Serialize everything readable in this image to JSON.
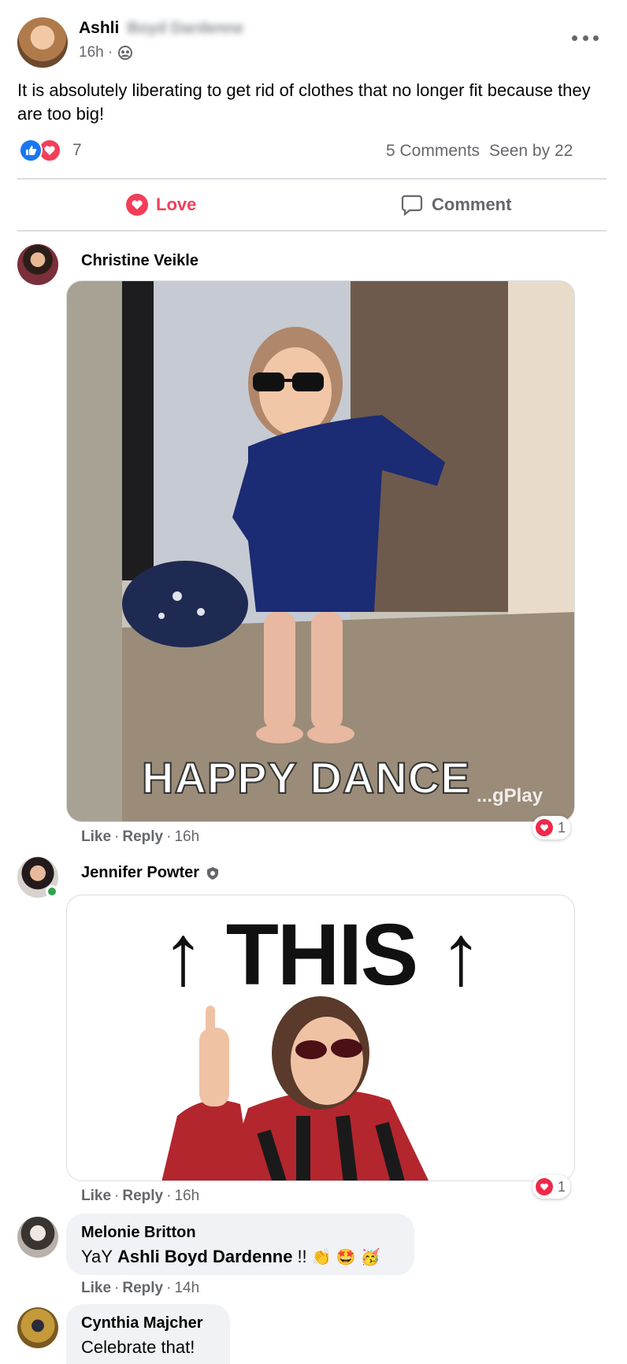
{
  "post": {
    "author_first": "Ashli",
    "author_blurred": "Boyd Dardenne",
    "time": "16h ·",
    "text": "It is absolutely liberating to get rid of clothes that no longer fit because they are too big!",
    "reaction_count": "7",
    "comments_count": "5 Comments",
    "seen_by": "Seen by 22",
    "love_label": "Love",
    "comment_label": "Comment",
    "more_icon": "more-horizontal-icon",
    "audience_icon": "group-icon"
  },
  "comments": [
    {
      "name": "Christine Veikle",
      "gif_caption": "HAPPY DANCE",
      "gif_watermark": "...gPlay",
      "like": "Like",
      "reply": "Reply",
      "time": "16h",
      "reaction_count": "1"
    },
    {
      "name": "Jennifer Powter",
      "gif_caption": "↑ THIS ↑",
      "like": "Like",
      "reply": "Reply",
      "time": "16h",
      "reaction_count": "1"
    },
    {
      "name": "Melonie Britton",
      "text_prefix": "YaY",
      "mention": "Ashli Boyd Dardenne",
      "text_suffix": "!!",
      "like": "Like",
      "reply": "Reply",
      "time": "14h"
    },
    {
      "name": "Cynthia Majcher",
      "text": "Celebrate that!"
    }
  ],
  "colors": {
    "love": "#f33e58",
    "like_blue": "#1877f2",
    "muted": "#65676b"
  }
}
